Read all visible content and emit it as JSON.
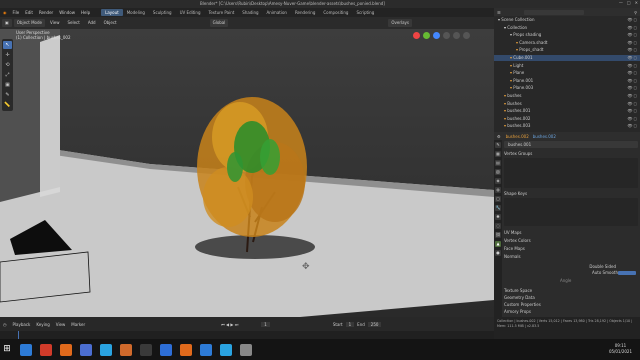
{
  "window": {
    "title": "Blender* [C:\\Users\\Rubin\\Desktop\\Amesy-Nuver-Game\\blender-assets\\bushes_ponied.blend]",
    "controls": [
      "—",
      "□",
      "✕"
    ]
  },
  "menu": {
    "items": [
      "File",
      "Edit",
      "Render",
      "Window",
      "Help"
    ],
    "tabs": [
      "Layout",
      "Modeling",
      "Sculpting",
      "UV Editing",
      "Texture Paint",
      "Shading",
      "Animation",
      "Rendering",
      "Compositing",
      "Scripting"
    ],
    "active_tab": "Layout",
    "scene": "Scene",
    "view_layer": "View Layer"
  },
  "viewport": {
    "mode": "Object Mode",
    "menus": [
      "View",
      "Select",
      "Add",
      "Object"
    ],
    "info_line1": "User Perspective",
    "info_line2": "(1) Collection | bushes_002",
    "orientation": "Global",
    "shading": "Overlays"
  },
  "toolbar": {
    "tools": [
      "↖",
      "✛",
      "⟲",
      "⤢",
      "▣",
      "✎",
      "📏"
    ]
  },
  "outliner": {
    "title": "Scene Collection",
    "rows": [
      {
        "label": "Scene Collection",
        "indent": 0,
        "color": "#cccccc",
        "sel": false
      },
      {
        "label": "Collection",
        "indent": 1,
        "color": "#e0e0e0",
        "sel": false
      },
      {
        "label": "Props shading",
        "indent": 2,
        "color": "#cccccc",
        "sel": false
      },
      {
        "label": "Camera.shadt",
        "indent": 3,
        "color": "#e8a03c",
        "sel": false
      },
      {
        "label": "Props_shadt",
        "indent": 3,
        "color": "#e8a03c",
        "sel": false
      },
      {
        "label": "Cube.001",
        "indent": 2,
        "color": "#e8a03c",
        "sel": true
      },
      {
        "label": "Light",
        "indent": 2,
        "color": "#e8a03c",
        "sel": false
      },
      {
        "label": "Plane",
        "indent": 2,
        "color": "#e8a03c",
        "sel": false
      },
      {
        "label": "Plane.001",
        "indent": 2,
        "color": "#e8a03c",
        "sel": false
      },
      {
        "label": "Plane.003",
        "indent": 2,
        "color": "#e8a03c",
        "sel": false
      },
      {
        "label": "bushes",
        "indent": 1,
        "color": "#e8a03c",
        "sel": false
      },
      {
        "label": "Bushes",
        "indent": 1,
        "color": "#e8a03c",
        "sel": false
      },
      {
        "label": "bushes.001",
        "indent": 1,
        "color": "#e8a03c",
        "sel": false
      },
      {
        "label": "bushes.002",
        "indent": 1,
        "color": "#e8a03c",
        "sel": false
      },
      {
        "label": "bushes.003",
        "indent": 1,
        "color": "#e8a03c",
        "sel": false
      }
    ]
  },
  "properties": {
    "object_name": "bushes.002",
    "mesh_name": "bushes.002",
    "data_name": "bushes.001",
    "sections_top": [
      "Vertex Groups",
      "Shape Keys"
    ],
    "sections_mid": [
      "UV Maps",
      "Vertex Colors",
      "Face Maps",
      "Normals"
    ],
    "auto_smooth_label": "Auto Smooth",
    "double_sided_label": "Double Sided",
    "angle_label": "Angle",
    "sections_bottom": [
      "Texture Space",
      "Geometry Data",
      "Custom Properties",
      "Armory Props"
    ]
  },
  "timeline": {
    "menus": [
      "Playback",
      "Keying",
      "View",
      "Marker"
    ],
    "frame": "1",
    "start_label": "Start",
    "start": "1",
    "end_label": "End",
    "end": "250"
  },
  "status_bar": "Collection | bushes.002 | Verts 15,012 | Faces 13,980 | Tris 28,192 | Objects 1/10 | Mem: 111.5 MiB | v2.83.5",
  "taskbar": {
    "time": "09:11",
    "date": "05/01/2021",
    "icons": [
      "#2d7bd6",
      "#d13b2a",
      "#e06a1c",
      "#4b6ed1",
      "#2aa3e0",
      "#d06a2c",
      "#3a3a3a",
      "#2d6ed6",
      "#e06a1c",
      "#2d7bd6",
      "#2aa3e0",
      "#888888"
    ]
  }
}
